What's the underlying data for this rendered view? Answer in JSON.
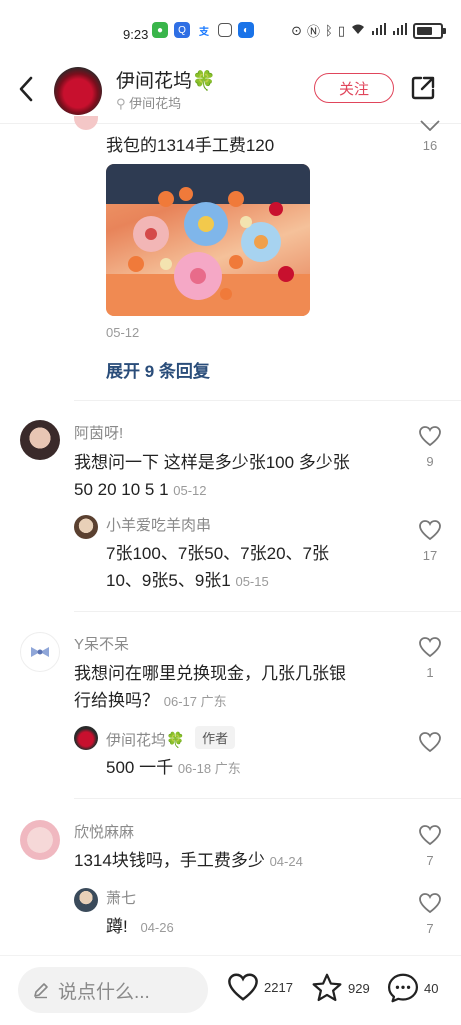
{
  "status_bar": {
    "time": "9:23"
  },
  "header": {
    "title": "伊间花坞🍀",
    "location": "伊间花坞",
    "follow_label": "关注"
  },
  "comments": [
    {
      "text": "我包的1314手工费120",
      "date": "05-12",
      "likes": "16",
      "expand_label": "展开 9 条回复"
    },
    {
      "name": "阿茵呀!",
      "text_line1": "我想问一下 这样是多少张100 多少张",
      "text_line2": "50 20 10 5 1",
      "date": "05-12",
      "likes": "9",
      "reply": {
        "name": "小羊爱吃羊肉串",
        "text_line1": "7张100、7张50、7张20、7张",
        "text_line2": "10、9张5、9张1",
        "date": "05-15",
        "likes": "17"
      }
    },
    {
      "name": "Y呆不呆",
      "text_line1": "我想问在哪里兑换现金，几张几张银",
      "text_line2": "行给换吗？",
      "date": "06-17 广东",
      "likes": "1",
      "reply": {
        "name": "伊间花坞🍀",
        "tag": "作者",
        "text": "500 一千",
        "date": "06-18 广东",
        "likes": ""
      }
    },
    {
      "name": "欣悦麻麻",
      "text": "1314块钱吗，手工费多少",
      "date": "04-24",
      "likes": "7",
      "reply": {
        "name": "萧七",
        "text": "蹲!",
        "date": "04-26",
        "likes": "7"
      }
    }
  ],
  "bottom_bar": {
    "input_placeholder": "说点什么...",
    "like_count": "2217",
    "fav_count": "929",
    "comment_count": "40"
  },
  "colors": {
    "accent": "#e0455b",
    "link": "#2a4d7a",
    "muted": "#8a8a8a"
  }
}
